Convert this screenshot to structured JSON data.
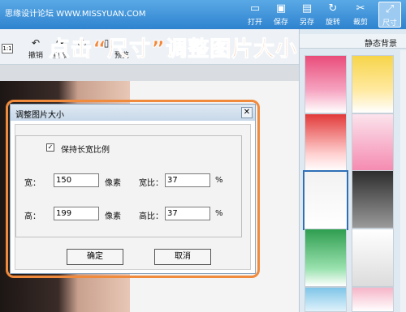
{
  "watermark": "思缘设计论坛  WWW.MISSYUAN.COM",
  "toolbar": {
    "open": "打开",
    "save": "保存",
    "saveas": "另存",
    "rotate": "旋转",
    "crop": "裁剪",
    "size": "尺寸",
    "icons": {
      "open": "folder-icon",
      "save": "floppy-icon",
      "saveas": "saveas-icon",
      "rotate": "rotate-icon",
      "crop": "scissors-icon",
      "size": "resize-icon"
    }
  },
  "subtoolbar": {
    "undo": "撤销",
    "redo": "重做",
    "preview": "预览",
    "ratio": "1:1"
  },
  "headline": {
    "pre": "点击",
    "quoted": "尺寸",
    "post": "调整图片大小"
  },
  "rightpanel": {
    "tab_static": "静态背景"
  },
  "dialog": {
    "title": "调整图片大小",
    "keep_ratio_label": "保持长宽比例",
    "keep_ratio_checked": true,
    "width_label": "宽：",
    "width_value": "150",
    "width_unit": "像素",
    "width_ratio_label": "宽比：",
    "width_ratio_value": "37",
    "width_ratio_unit": "%",
    "height_label": "高：",
    "height_value": "199",
    "height_unit": "像素",
    "height_ratio_label": "高比：",
    "height_ratio_value": "37",
    "height_ratio_unit": "%",
    "ok": "确定",
    "cancel": "取消"
  },
  "colors": {
    "accent": "#f08a3c",
    "bar": "#2e83cf"
  }
}
